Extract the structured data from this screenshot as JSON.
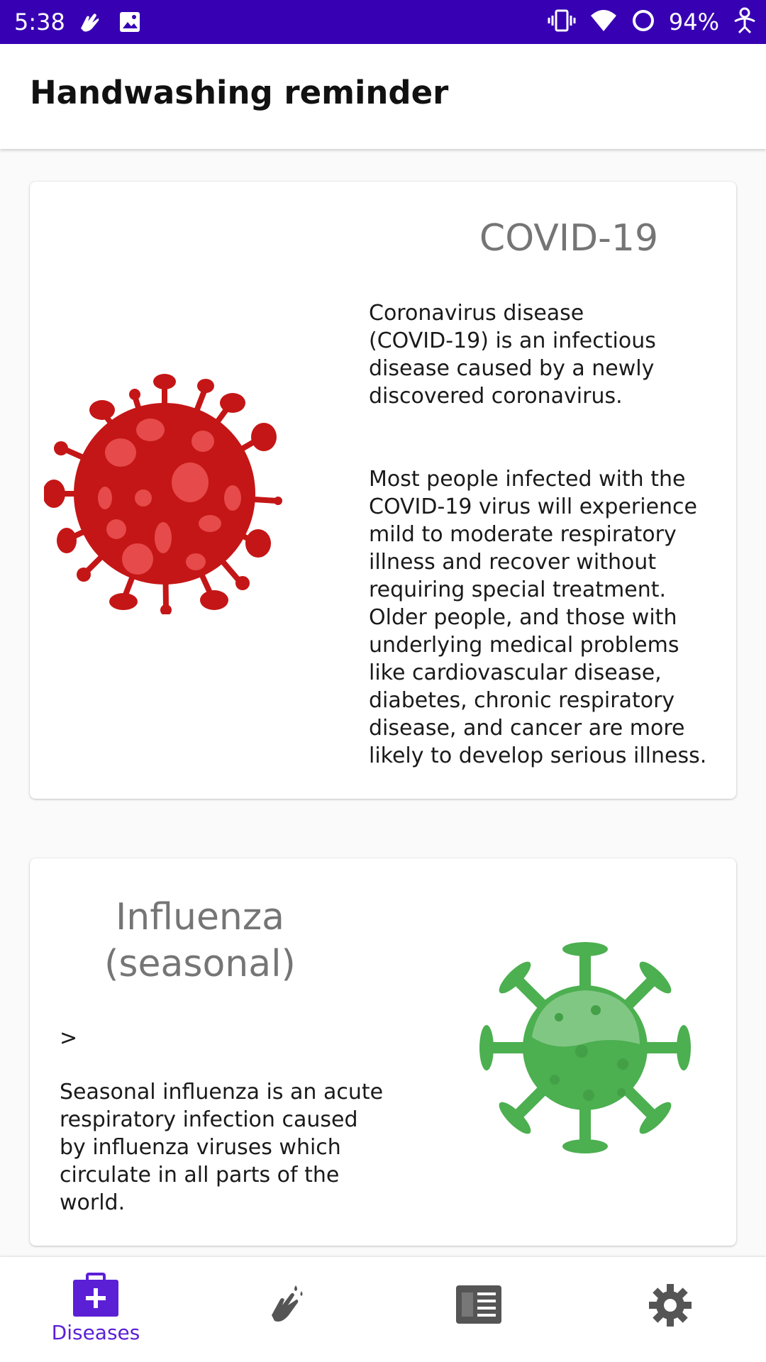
{
  "status_bar": {
    "time": "5:38",
    "battery": "94%",
    "color": "#3700b3"
  },
  "app_bar": {
    "title": "Handwashing reminder"
  },
  "cards": [
    {
      "title": "COVID-19",
      "icon": "red-virus-icon",
      "paragraph_1": "Coronavirus disease\n(COVID-19) is an infectious\ndisease caused by a newly\ndiscovered coronavirus.",
      "paragraph_2": "Most people infected with the\nCOVID-19 virus will experience\nmild to moderate respiratory\nillness and recover without\nrequiring special treatment.\nOlder people, and those with\nunderlying medical problems\nlike cardiovascular disease,\ndiabetes, chronic respiratory\ndisease, and cancer are more\nlikely to develop serious illness.",
      "accent": "#c41616"
    },
    {
      "title_line_1": "Influenza",
      "title_line_2": "(seasonal)",
      "icon": "green-virus-icon",
      "marker": ">",
      "paragraph_1": "Seasonal influenza is an acute\nrespiratory infection caused\nby influenza viruses which\ncirculate in all parts of the\nworld.",
      "accent": "#4caf50"
    }
  ],
  "bottom_nav": {
    "active_color": "#5b1fd6",
    "items": [
      {
        "label": "Diseases",
        "icon": "medical-kit-icon",
        "active": true
      },
      {
        "label": "",
        "icon": "handwash-icon",
        "active": false
      },
      {
        "label": "",
        "icon": "news-icon",
        "active": false
      },
      {
        "label": "",
        "icon": "settings-gear-icon",
        "active": false
      }
    ]
  }
}
